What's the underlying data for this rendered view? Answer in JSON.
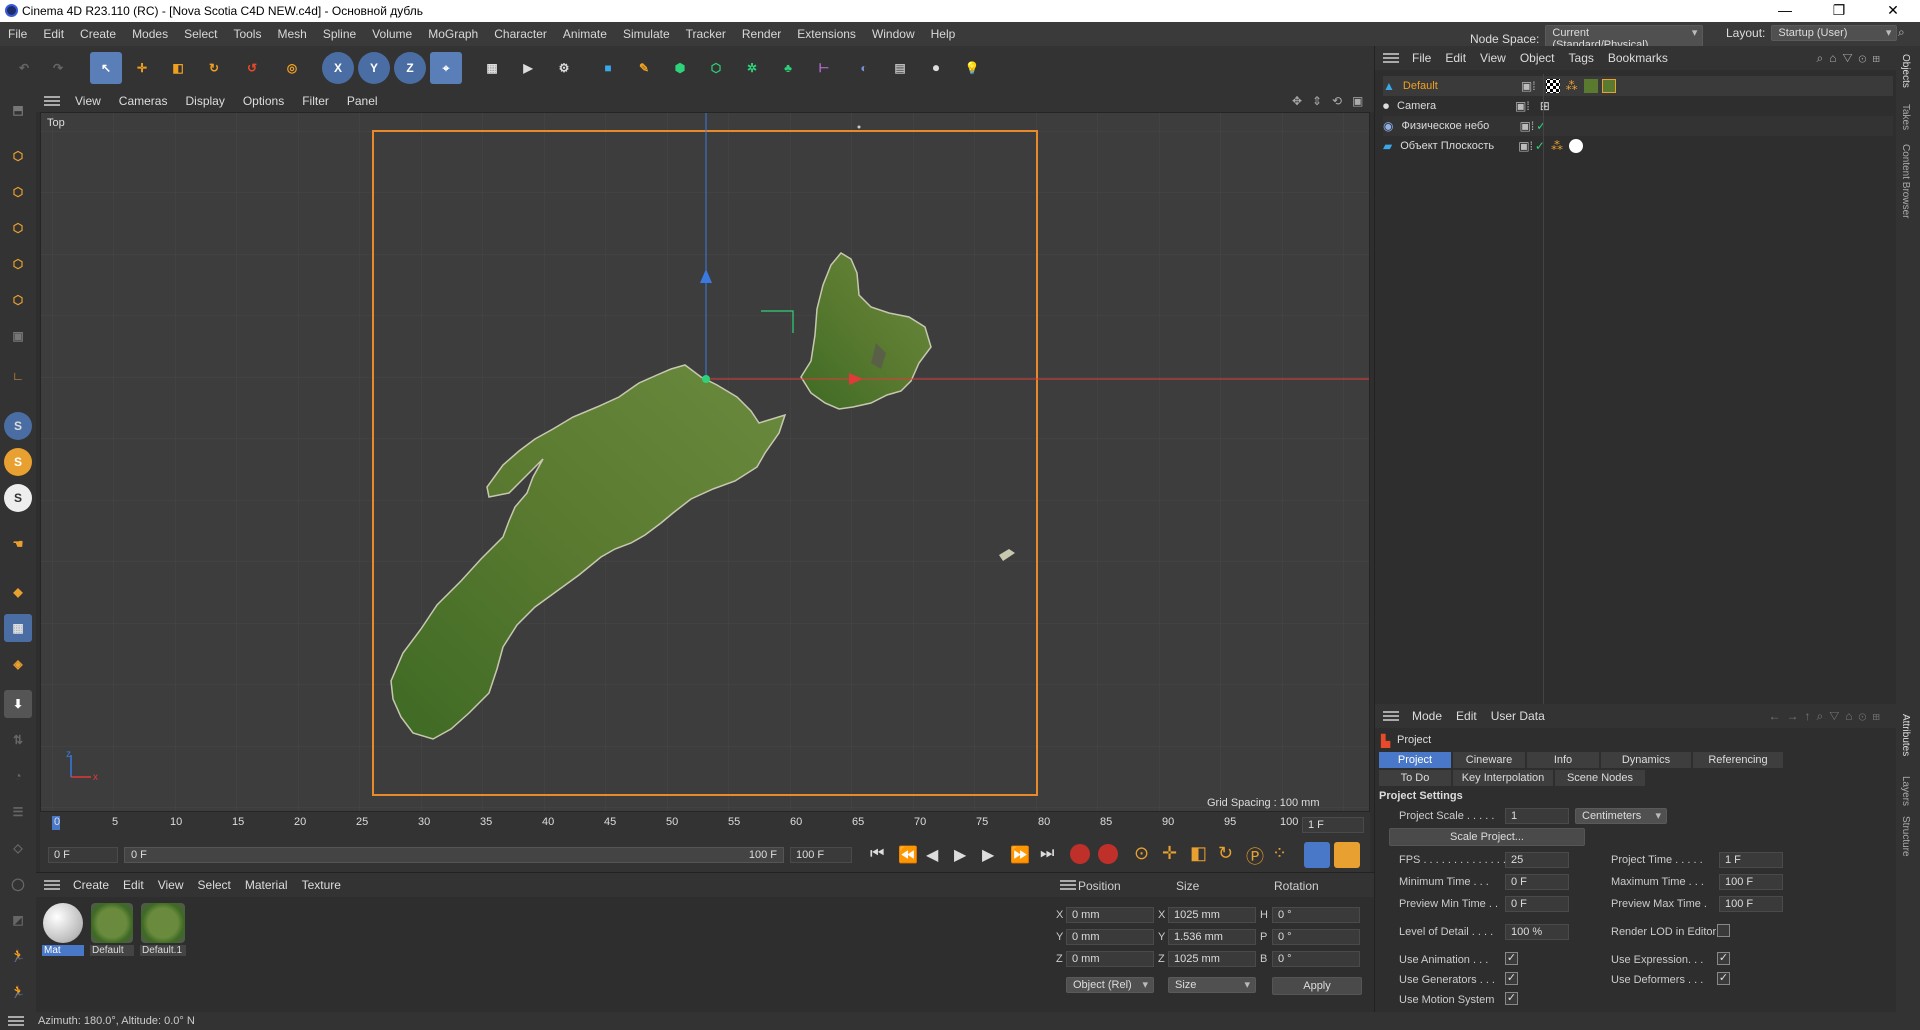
{
  "window": {
    "title": "Cinema 4D R23.110 (RC) - [Nova Scotia C4D NEW.c4d] - Основной дубль",
    "minimize": "—",
    "maximize": "❐",
    "close": "✕"
  },
  "menu": [
    "File",
    "Edit",
    "Create",
    "Modes",
    "Select",
    "Tools",
    "Mesh",
    "Spline",
    "Volume",
    "MoGraph",
    "Character",
    "Animate",
    "Simulate",
    "Tracker",
    "Render",
    "Extensions",
    "Window",
    "Help"
  ],
  "nodespace": {
    "label": "Node Space:",
    "value": "Current (Standard/Physical)"
  },
  "layout": {
    "label": "Layout:",
    "value": "Startup (User)"
  },
  "toolbar": {
    "x_axis": "X",
    "y_axis": "Y",
    "z_axis": "Z"
  },
  "viewport": {
    "menu": [
      "View",
      "Cameras",
      "Display",
      "Options",
      "Filter",
      "Panel"
    ],
    "name": "Top",
    "grid_spacing": "Grid Spacing : 100 mm",
    "axis_y": "z",
    "axis_x": "x"
  },
  "timeline": {
    "ticks": [
      "0",
      "5",
      "10",
      "15",
      "20",
      "25",
      "30",
      "35",
      "40",
      "45",
      "50",
      "55",
      "60",
      "65",
      "70",
      "75",
      "80",
      "85",
      "90",
      "95",
      "100"
    ],
    "current_frame": "1 F"
  },
  "transport": {
    "start": "0 F",
    "range_start": "0 F",
    "range_end": "100 F",
    "end": "100 F"
  },
  "material_manager": {
    "menu": [
      "Create",
      "Edit",
      "View",
      "Select",
      "Material",
      "Texture"
    ],
    "materials": [
      "Mat",
      "Default",
      "Default.1"
    ]
  },
  "coordinates": {
    "headers": [
      "Position",
      "Size",
      "Rotation"
    ],
    "rows": [
      {
        "axis": "X",
        "pos": "0 mm",
        "size_axis": "X",
        "size": "1025 mm",
        "rot_axis": "H",
        "rot": "0 °"
      },
      {
        "axis": "Y",
        "pos": "0 mm",
        "size_axis": "Y",
        "size": "1.536 mm",
        "rot_axis": "P",
        "rot": "0 °"
      },
      {
        "axis": "Z",
        "pos": "0 mm",
        "size_axis": "Z",
        "size": "1025 mm",
        "rot_axis": "B",
        "rot": "0 °"
      }
    ],
    "mode": "Object (Rel)",
    "size_mode": "Size",
    "apply": "Apply"
  },
  "object_manager": {
    "menu": [
      "File",
      "Edit",
      "View",
      "Object",
      "Tags",
      "Bookmarks"
    ],
    "objects": [
      {
        "name": "Default"
      },
      {
        "name": "Camera"
      },
      {
        "name": "Физическое небо"
      },
      {
        "name": "Объект Плоскость"
      }
    ]
  },
  "attributes": {
    "menu": [
      "Mode",
      "Edit",
      "User Data"
    ],
    "title": "Project",
    "tabs_row1": [
      "Project Settings",
      "Cineware",
      "Info",
      "Dynamics",
      "Referencing"
    ],
    "tabs_row2": [
      "To Do",
      "Key Interpolation",
      "Scene Nodes"
    ],
    "section": "Project Settings",
    "project_scale_label": "Project Scale . . . . .",
    "project_scale": "1",
    "scale_unit": "Centimeters",
    "scale_button": "Scale Project...",
    "fps_label": "FPS . . . . . . . . . . . . . .",
    "fps": "25",
    "project_time_label": "Project Time . . . . .",
    "project_time": "1 F",
    "min_time_label": "Minimum Time . . .",
    "min_time": "0 F",
    "max_time_label": "Maximum Time . . .",
    "max_time": "100 F",
    "prev_min_label": "Preview Min Time . .",
    "prev_min": "0 F",
    "prev_max_label": "Preview Max Time .",
    "prev_max": "100 F",
    "lod_label": "Level of Detail . . . .",
    "lod": "100 %",
    "render_lod_label": "Render LOD in Editor",
    "use_animation": "Use Animation . . .",
    "use_expression": "Use Expression. . .",
    "use_generators": "Use Generators . . .",
    "use_deformers": "Use Deformers . . .",
    "use_motion": "Use Motion System"
  },
  "right_tabs": [
    "Objects",
    "Takes",
    "Content Browser",
    "Attributes",
    "Layers",
    "Structure"
  ],
  "status": "Azimuth: 180.0°, Altitude: 0.0°  N"
}
